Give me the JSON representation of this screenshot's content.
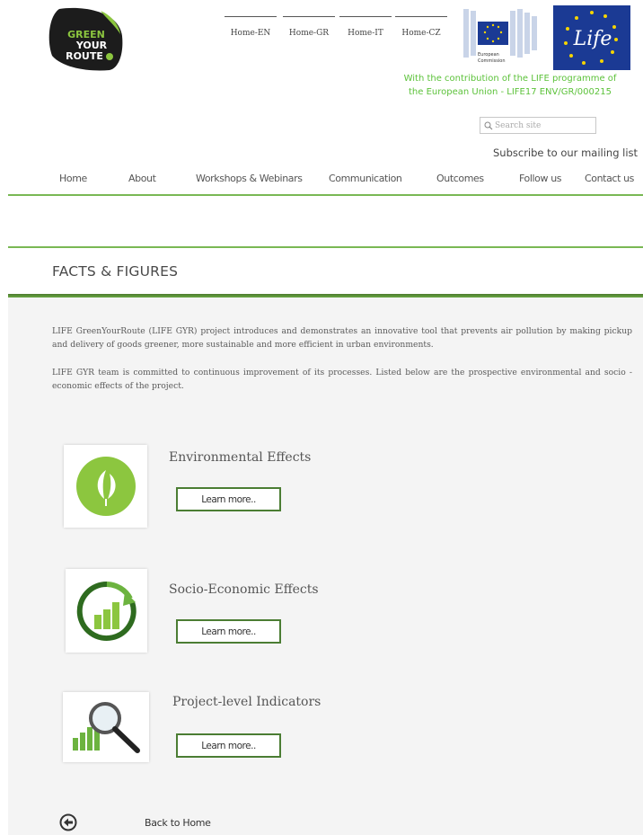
{
  "header": {
    "logo": {
      "line1": "GREEN",
      "line2": "YOUR",
      "line3": "ROUTE"
    },
    "languages": [
      "Home-EN",
      "Home-GR",
      "Home-IT",
      "Home-CZ"
    ],
    "ec_logo": {
      "line1": "European",
      "line2": "Commission"
    },
    "life_logo": {
      "text": "Life"
    },
    "contribution_line1": "With the contribution of the LIFE programme of",
    "contribution_line2": "the European Union - LIFE17 ENV/GR/000215",
    "search": {
      "placeholder": "Search site",
      "icon": "search-icon"
    },
    "subscribe": "Subscribe to our mailing list"
  },
  "nav": {
    "items": [
      "Home",
      "About",
      "Workshops & Webinars",
      "Communication",
      "Outcomes",
      "Follow us",
      "Contact us"
    ]
  },
  "page": {
    "title": "FACTS & FIGURES",
    "intro1": "LIFE GreenYourRoute (LIFE GYR) project introduces and demonstrates an innovative tool that prevents air pollution by making pickup and delivery of goods greener, more sustainable and more efficient in urban environments.",
    "intro2": "LIFE GYR team is committed to continuous improvement of its processes. Listed below are the prospective environmental and socio - economic effects of the project."
  },
  "effects": [
    {
      "title": "Environmental Effects",
      "button": "Learn more..",
      "icon": "leaf-icon"
    },
    {
      "title": "Socio-Economic Effects",
      "button": "Learn more..",
      "icon": "growth-chart-icon"
    },
    {
      "title": "Project-level Indicators",
      "button": "Learn more..",
      "icon": "magnifier-chart-icon"
    }
  ],
  "footer": {
    "back_label": "Back to Home",
    "back_icon": "circle-arrow-left-icon"
  },
  "colors": {
    "accent_green": "#79b854",
    "dark_green": "#4b7d33",
    "text_green": "#5cc23a",
    "eu_blue": "#1b3a94"
  }
}
